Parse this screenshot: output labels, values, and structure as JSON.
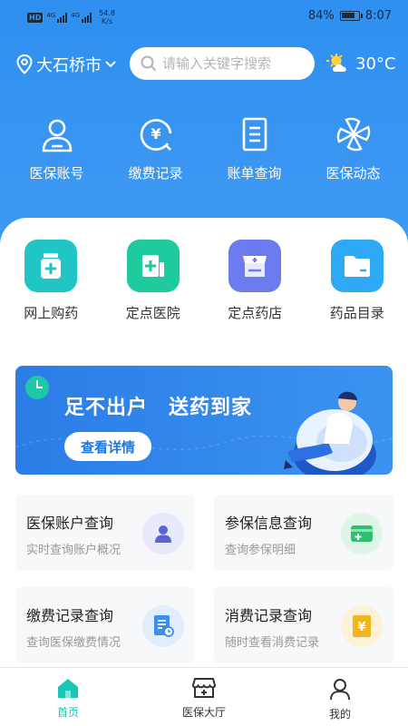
{
  "status": {
    "hd": "HD",
    "sig1": "4G",
    "sig2": "4G",
    "speed_value": "54.8",
    "speed_unit": "K/s",
    "battery": "84%",
    "battery_level": 0.84,
    "time": "8:07"
  },
  "header": {
    "city": "大石桥市",
    "search_placeholder": "请输入关键字搜索",
    "temperature": "30°C"
  },
  "quick_actions": [
    {
      "label": "医保账号",
      "icon": "user-icon"
    },
    {
      "label": "缴费记录",
      "icon": "yuan-clock-icon"
    },
    {
      "label": "账单查询",
      "icon": "bill-icon"
    },
    {
      "label": "医保动态",
      "icon": "pinwheel-icon"
    }
  ],
  "services": [
    {
      "label": "网上购药",
      "icon": "medicine-bottle-icon",
      "color": "#22c5c6"
    },
    {
      "label": "定点医院",
      "icon": "hospital-icon",
      "color": "#1fca9c"
    },
    {
      "label": "定点药店",
      "icon": "pharmacy-icon",
      "color": "#6b7cf0"
    },
    {
      "label": "药品目录",
      "icon": "folder-icon",
      "color": "#2ea9f5"
    }
  ],
  "banner": {
    "title": "足不出户　送药到家",
    "button": "查看详情"
  },
  "cards": [
    {
      "title": "医保账户查询",
      "subtitle": "实时查询账户概况",
      "icon": "person-icon",
      "icon_color": "#5b63d8",
      "icon_bg": "#e8e9fb"
    },
    {
      "title": "参保信息查询",
      "subtitle": "查询参保明细",
      "icon": "card-plus-icon",
      "icon_color": "#2fbf71",
      "icon_bg": "#dff5e8"
    },
    {
      "title": "缴费记录查询",
      "subtitle": "查询医保缴费情况",
      "icon": "document-clock-icon",
      "icon_color": "#3a8ef0",
      "icon_bg": "#e0eefd"
    },
    {
      "title": "消费记录查询",
      "subtitle": "随时查看消费记录",
      "icon": "yuan-receipt-icon",
      "icon_color": "#f2b51e",
      "icon_bg": "#fdf1d8"
    }
  ],
  "tabbar": [
    {
      "label": "首页",
      "icon": "home-icon",
      "active": true
    },
    {
      "label": "医保大厅",
      "icon": "store-icon",
      "active": false
    },
    {
      "label": "我的",
      "icon": "profile-icon",
      "active": false
    }
  ],
  "colors": {
    "primary": "#3a96f2",
    "tab_active": "#1ac6b3"
  }
}
